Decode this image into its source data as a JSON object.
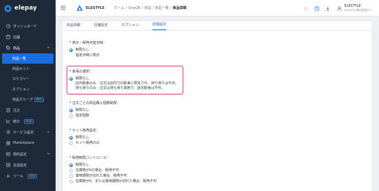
{
  "sidebar": {
    "logo_text": "elepay",
    "items": [
      {
        "label": "ダッシュボード",
        "icon": "dashboard-icon"
      },
      {
        "label": "店舗",
        "icon": "store-icon"
      },
      {
        "label": "商品",
        "icon": "tag-icon",
        "expanded": true
      }
    ],
    "sub_items": [
      {
        "label": "商品一覧",
        "active": true
      },
      {
        "label": "商品セット"
      },
      {
        "label": "カテゴリー"
      },
      {
        "label": "オプション"
      },
      {
        "label": "商品グループ",
        "badge": "Beta"
      }
    ],
    "items_after": [
      {
        "label": "注文",
        "icon": "order-icon"
      },
      {
        "label": "統計",
        "icon": "stats-icon",
        "badge": "Beta"
      },
      {
        "label": "サービス設定",
        "icon": "settings-icon",
        "chevron": true
      },
      {
        "label": "Marketplace",
        "icon": "marketplace-icon"
      },
      {
        "label": "規約設定",
        "icon": "document-icon",
        "chevron": true
      },
      {
        "label": "言語設定",
        "icon": "language-icon"
      },
      {
        "label": "ツール",
        "icon": "tool-icon",
        "badge": "Beta"
      }
    ]
  },
  "header": {
    "brand": "ELESTYLE",
    "breadcrumb": [
      "ホーム",
      "OneQR",
      "商品",
      "商品一覧",
      "商品詳細"
    ],
    "user_name": "ELESTYLE",
    "user_org": "ELESTYLE株式会社(デ..."
  },
  "tabs": [
    {
      "label": "商品情報",
      "active": false
    },
    {
      "label": "店舗設定",
      "active": false
    },
    {
      "label": "オプション",
      "active": false
    },
    {
      "label": "詳細設定",
      "active": true
    }
  ],
  "sections": [
    {
      "label": "表示・販売可能日時：",
      "options": [
        {
          "label": "制限なし",
          "checked": true
        },
        {
          "label": "指定日時に表示",
          "checked": false,
          "no_radio": true
        }
      ]
    },
    {
      "label": "食事の選択：",
      "options": [
        {
          "label": "制限なし",
          "checked": true,
          "desc": [
            "店内飲食のみ - 注文は店内での飲食に限定され、持ち帰りは不可。",
            "持ち帰りのみ - 注文は持ち帰り専用で、店内飲食は不可。"
          ]
        }
      ]
    },
    {
      "label": "注文ごとの商品購入個数制限：",
      "options": [
        {
          "label": "制限なし",
          "checked": true
        },
        {
          "label": "指定個数",
          "checked": false
        }
      ]
    },
    {
      "label": "セット販売設定：",
      "options": [
        {
          "label": "制限なし",
          "checked": true
        },
        {
          "label": "セット販売のみ",
          "checked": false
        }
      ]
    },
    {
      "label": "販売制限コントロール：",
      "options": [
        {
          "label": "制限なし",
          "checked": true
        },
        {
          "label": "在庫数が0の場合、販売不可",
          "checked": false
        },
        {
          "label": "賞味期限が切れた場合、販売不可",
          "checked": false
        },
        {
          "label": "在庫数が0、または賞味期限が切れた場合、販売不可",
          "checked": false
        }
      ]
    }
  ],
  "colors": {
    "accent": "#1a6fe0",
    "sidebar_bg": "#1e2a3a",
    "highlight": "#e0318f"
  }
}
